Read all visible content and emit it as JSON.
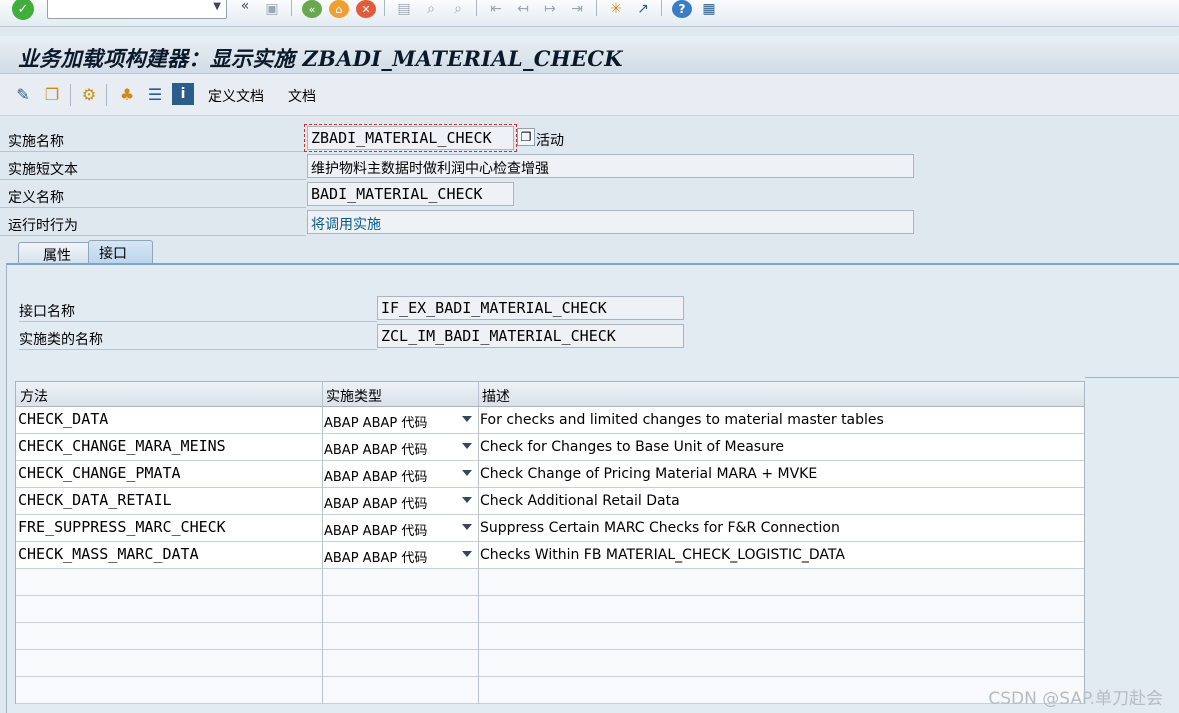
{
  "system_toolbar": {
    "icons": [
      "enter-check-icon",
      "chevron-double-left-icon",
      "save-icon",
      "back-icon",
      "exit-icon",
      "cancel-icon",
      "print-icon",
      "find-icon",
      "find-next-icon",
      "first-page-icon",
      "prev-page-icon",
      "next-page-icon",
      "last-page-icon",
      "new-session-icon",
      "shortcut-icon",
      "help-icon",
      "customize-layout-icon"
    ],
    "command_field_value": ""
  },
  "title": "业务加载项构建器：显示实施 ZBADI_MATERIAL_CHECK",
  "app_toolbar": {
    "icons": [
      "display-change-icon",
      "other-object-icon",
      "activate-icon",
      "object-list-icon",
      "hierarchy-icon",
      "info-icon"
    ],
    "define_docs_label": "定义文档",
    "docs_label": "文档"
  },
  "header": {
    "impl_name_label": "实施名称",
    "impl_name_value": "ZBADI_MATERIAL_CHECK",
    "active_label": "活动",
    "short_text_label": "实施短文本",
    "short_text_value": "维护物料主数据时做利润中心检查增强",
    "definition_label": "定义名称",
    "definition_value": "BADI_MATERIAL_CHECK",
    "runtime_label": "运行时行为",
    "runtime_value": "将调用实施"
  },
  "tabs": [
    {
      "label": "属性",
      "active": false
    },
    {
      "label": "接口",
      "active": true
    }
  ],
  "interface": {
    "interface_name_label": "接口名称",
    "interface_name_value": "IF_EX_BADI_MATERIAL_CHECK",
    "class_name_label": "实施类的名称",
    "class_name_value": "ZCL_IM_BADI_MATERIAL_CHECK"
  },
  "methods_table": {
    "headers": [
      "方法",
      "实施类型",
      "描述"
    ],
    "rows": [
      {
        "method": "CHECK_DATA",
        "type": "ABAP ABAP 代码",
        "desc": "For checks and limited changes to material master tables"
      },
      {
        "method": "CHECK_CHANGE_MARA_MEINS",
        "type": "ABAP ABAP 代码",
        "desc": "Check for Changes to Base Unit of Measure"
      },
      {
        "method": "CHECK_CHANGE_PMATA",
        "type": "ABAP ABAP 代码",
        "desc": "Check Change of Pricing Material MARA + MVKE"
      },
      {
        "method": "CHECK_DATA_RETAIL",
        "type": "ABAP ABAP 代码",
        "desc": "Check Additional Retail Data"
      },
      {
        "method": "FRE_SUPPRESS_MARC_CHECK",
        "type": "ABAP ABAP 代码",
        "desc": "Suppress Certain MARC Checks for F&R Connection"
      },
      {
        "method": "CHECK_MASS_MARC_DATA",
        "type": "ABAP ABAP 代码",
        "desc": "Checks Within FB MATERIAL_CHECK_LOGISTIC_DATA"
      }
    ]
  },
  "watermark": "CSDN @SAP.单刀赴会",
  "colors": {
    "link": "#0b5a8d",
    "tab_active": "#bcd4ec",
    "background": "#dfe7ef"
  }
}
